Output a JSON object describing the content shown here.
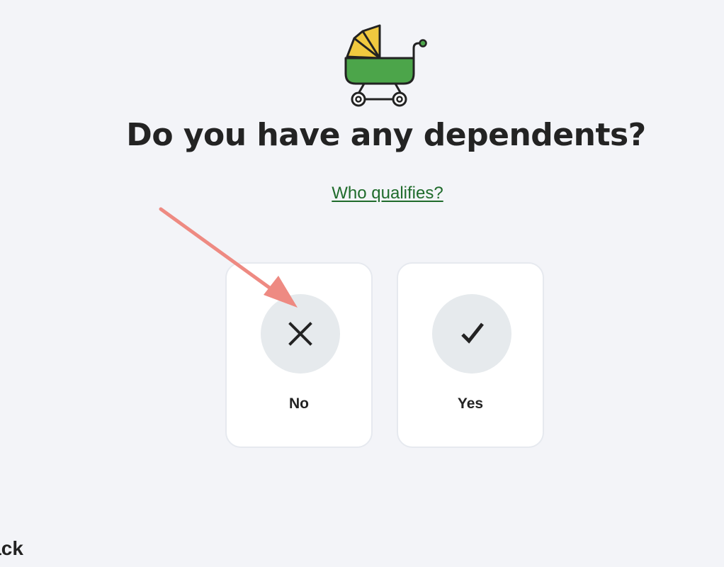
{
  "question": {
    "title": "Do you have any dependents?",
    "help_link": "Who qualifies?"
  },
  "illustration": {
    "icon": "baby-stroller-icon",
    "colors": {
      "canopy": "#f0c93f",
      "basket": "#4ca54a",
      "outline": "#222222"
    }
  },
  "choices": [
    {
      "label": "No",
      "icon": "x-icon"
    },
    {
      "label": "Yes",
      "icon": "checkmark-icon"
    }
  ],
  "footer": {
    "back_label": "Back"
  },
  "annotation": {
    "arrow_color": "#ee8a82"
  }
}
